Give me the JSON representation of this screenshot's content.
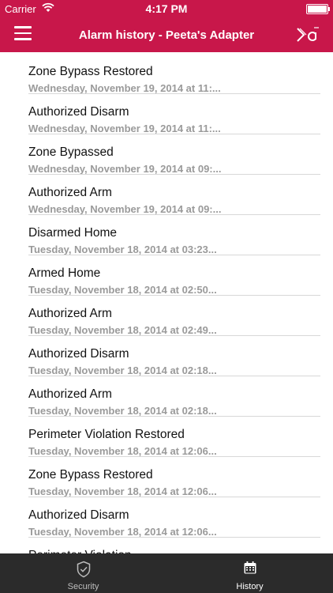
{
  "status_bar": {
    "carrier": "Carrier",
    "time": "4:17 PM",
    "battery_level": 1.0
  },
  "nav": {
    "title": "Alarm history - Peeta's Adapter"
  },
  "events": [
    {
      "title": "Zone Bypass Restored",
      "subtitle": "Wednesday, November 19, 2014 at 11:..."
    },
    {
      "title": "Authorized Disarm",
      "subtitle": "Wednesday, November 19, 2014 at 11:..."
    },
    {
      "title": "Zone Bypassed",
      "subtitle": "Wednesday, November 19, 2014 at 09:..."
    },
    {
      "title": "Authorized Arm",
      "subtitle": "Wednesday, November 19, 2014 at 09:..."
    },
    {
      "title": "Disarmed Home",
      "subtitle": "Tuesday, November 18, 2014 at 03:23..."
    },
    {
      "title": "Armed Home",
      "subtitle": "Tuesday, November 18, 2014 at 02:50..."
    },
    {
      "title": "Authorized Arm",
      "subtitle": "Tuesday, November 18, 2014 at 02:49..."
    },
    {
      "title": "Authorized Disarm",
      "subtitle": "Tuesday, November 18, 2014 at 02:18..."
    },
    {
      "title": "Authorized Arm",
      "subtitle": "Tuesday, November 18, 2014 at 02:18..."
    },
    {
      "title": "Perimeter Violation Restored",
      "subtitle": "Tuesday, November 18, 2014 at 12:06..."
    },
    {
      "title": "Zone Bypass Restored",
      "subtitle": "Tuesday, November 18, 2014 at 12:06..."
    },
    {
      "title": "Authorized Disarm",
      "subtitle": "Tuesday, November 18, 2014 at 12:06..."
    },
    {
      "title": "Perimeter Violation",
      "subtitle": ""
    }
  ],
  "tabs": [
    {
      "label": "Security",
      "icon": "shield-icon",
      "active": false
    },
    {
      "label": "History",
      "icon": "calendar-icon",
      "active": true
    }
  ],
  "colors": {
    "brand": "#c8174a",
    "tab_bar": "#2b2b2b"
  }
}
